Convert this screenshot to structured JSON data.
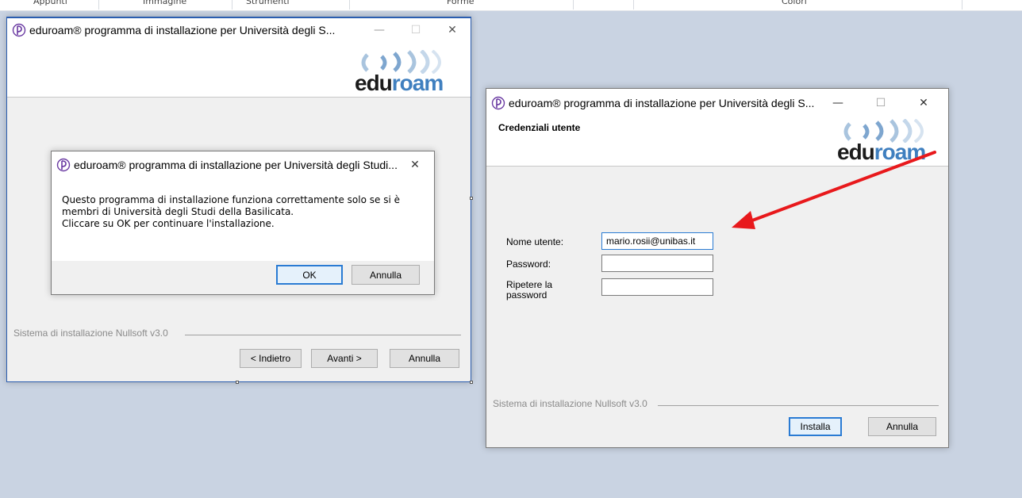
{
  "ribbon": {
    "items": [
      "Appunti",
      "Immagine",
      "Strumenti",
      "Forme",
      "Colori"
    ]
  },
  "window_a": {
    "title": "eduroam® programma di installazione per Università degli S...",
    "minimize": "—",
    "maximize": "☐",
    "close": "✕",
    "logo_edu": "edu",
    "logo_roam": "roam",
    "nsis": "Sistema di installazione Nullsoft v3.0",
    "back_button": "< Indietro",
    "next_button": "Avanti >",
    "cancel_button": "Annulla"
  },
  "msgbox": {
    "title": "eduroam® programma di installazione per Università degli Studi...",
    "close": "✕",
    "line1": "Questo programma di installazione funziona correttamente solo se si è",
    "line2": "membri di Università degli Studi della Basilicata.",
    "line3": "Cliccare su OK per continuare l'installazione.",
    "ok_button": "OK",
    "cancel_button": "Annulla"
  },
  "window_b": {
    "title": "eduroam® programma di installazione per Università degli S...",
    "minimize": "—",
    "maximize": "☐",
    "close": "✕",
    "heading": "Credenziali utente",
    "logo_edu": "edu",
    "logo_roam": "roam",
    "username_label": "Nome utente:",
    "username_value": "mario.rosii@unibas.it",
    "password_label": "Password:",
    "password_value": "",
    "repeat_label_1": "Ripetere la",
    "repeat_label_2": "password",
    "repeat_value": "",
    "nsis": "Sistema di installazione Nullsoft v3.0",
    "install_button": "Installa",
    "cancel_button": "Annulla"
  },
  "colors": {
    "canvas": "#c9d3e2",
    "annotation_arrow": "#e8191c",
    "eduroam_blue": "#3f7fbf",
    "focus_blue": "#2a7bd3"
  }
}
